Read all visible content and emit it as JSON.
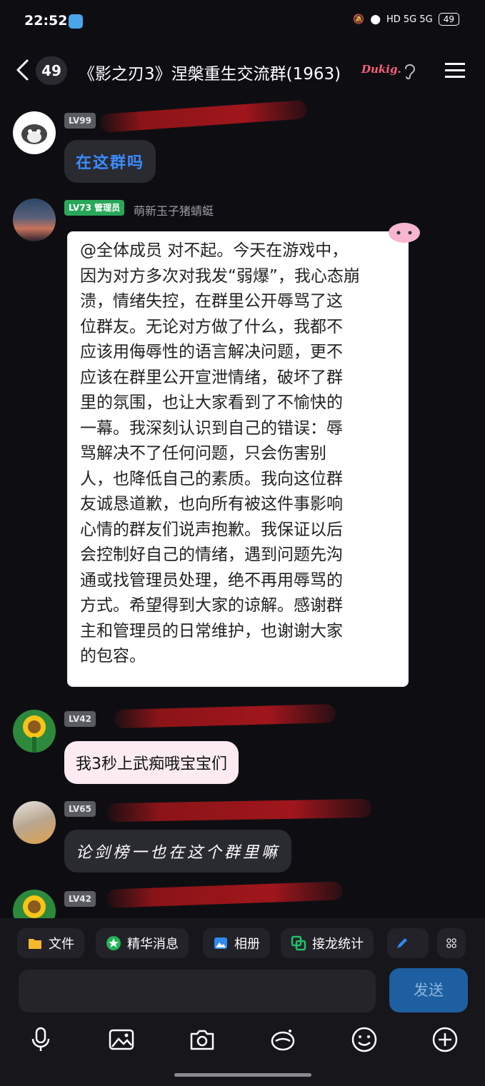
{
  "status_bar": {
    "time": "22:52",
    "network": "HD 5G 5G",
    "battery": "49"
  },
  "header": {
    "unread": "49",
    "title": "《影之刃3》涅槃重生交流群(1963)",
    "sticker_text": "Dukig."
  },
  "messages": [
    {
      "level": "LV99",
      "nickname": "",
      "text": "在这群吗"
    },
    {
      "level": "LV73 管理员",
      "nickname": "萌新玉子猪蜻蜓",
      "lines": [
        "@全体成员 对不起。今天在游戏中，",
        "因为对方多次对我发“弱爆”，我心态崩",
        "溃，情绪失控，在群里公开辱骂了这",
        "位群友。无论对方做了什么，我都不",
        "应该用侮辱性的语言解决问题，更不",
        "应该在群里公开宣泄情绪，破坏了群",
        "里的氛围，也让大家看到了不愉快的",
        "一幕。我深刻认识到自己的错误：辱",
        "骂解决不了任何问题，只会伤害别",
        "人，也降低自己的素质。我向这位群",
        "友诚恳道歉，也向所有被这件事影响",
        "心情的群友们说声抱歉。我保证以后",
        "会控制好自己的情绪，遇到问题先沟",
        "通或找管理员处理，绝不再用辱骂的",
        "方式。希望得到大家的谅解。感谢群",
        "主和管理员的日常维护，也谢谢大家",
        "的包容。"
      ]
    },
    {
      "level": "LV42",
      "nickname": "",
      "text": "我3秒上武痴哦宝宝们"
    },
    {
      "level": "LV65",
      "nickname": "",
      "text": "论剑榜一也在这个群里嘛"
    },
    {
      "level": "LV42",
      "nickname": ""
    }
  ],
  "toolbar": {
    "chips": [
      "文件",
      "精华消息",
      "相册",
      "接龙统计"
    ],
    "send": "发送"
  },
  "colors": {
    "accent_blue": "#3b8cff",
    "admin_green": "#2aa85a",
    "send_bg": "#1d5fa0"
  }
}
